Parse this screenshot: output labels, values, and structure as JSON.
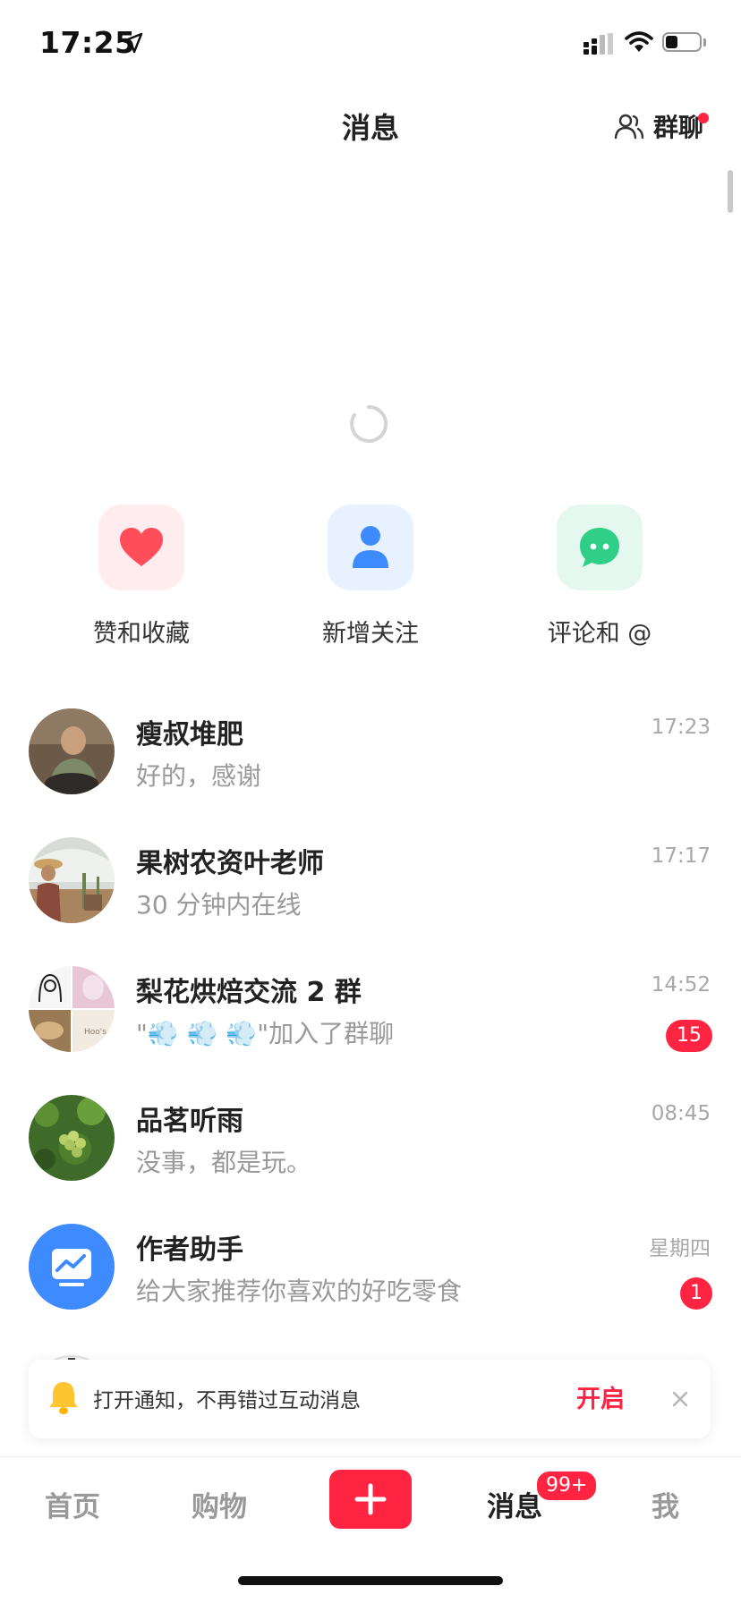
{
  "status_bar": {
    "time": "17:25"
  },
  "header": {
    "title": "消息",
    "group_chat_label": "群聊"
  },
  "quick_actions": [
    {
      "label": "赞和收藏",
      "icon": "heart-icon",
      "color": "#ff4d5a"
    },
    {
      "label": "新增关注",
      "icon": "person-icon",
      "color": "#3d8bff"
    },
    {
      "label": "评论和 @",
      "icon": "chat-bubble-icon",
      "color": "#2fcf8a"
    }
  ],
  "conversations": [
    {
      "name": "瘦叔堆肥",
      "preview": "好的，感谢",
      "time": "17:23",
      "unread": ""
    },
    {
      "name": "果树农资叶老师",
      "preview": "30 分钟内在线",
      "time": "17:17",
      "unread": ""
    },
    {
      "name": "梨花烘焙交流 2 群",
      "preview": "\"💨 💨 💨\"加入了群聊",
      "time": "14:52",
      "unread": "15"
    },
    {
      "name": "品茗听雨",
      "preview": "没事，都是玩。",
      "time": "08:45",
      "unread": ""
    },
    {
      "name": "作者助手",
      "preview": "给大家推荐你喜欢的好吃零食",
      "time": "星期四",
      "unread": "1"
    }
  ],
  "notify_banner": {
    "text": "打开通知，不再错过互动消息",
    "action": "开启"
  },
  "tab_bar": {
    "home": "首页",
    "shop": "购物",
    "messages": "消息",
    "messages_badge": "99+",
    "me": "我"
  },
  "colors": {
    "accent": "#ff2442",
    "muted_text": "#999999"
  }
}
